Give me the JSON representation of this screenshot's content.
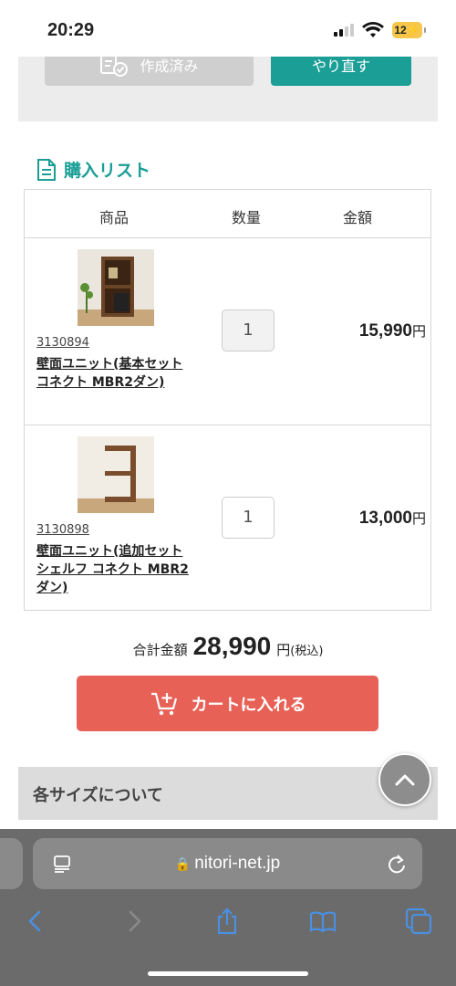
{
  "status": {
    "time": "20:29",
    "battery": "12"
  },
  "top_buttons": {
    "done_label": "作成済み",
    "redo_label": "やり直す"
  },
  "purchase_list": {
    "title": "購入リスト",
    "headers": [
      "商品",
      "数量",
      "金額"
    ],
    "items": [
      {
        "code": "3130894",
        "name": "壁面ユニット(基本セット コネクト MBR2ダン)",
        "qty": "1",
        "price": "15,990",
        "yen": "円"
      },
      {
        "code": "3130898",
        "name": "壁面ユニット(追加セット シェルフ コネクト MBR2ダン)",
        "qty": "1",
        "price": "13,000",
        "yen": "円"
      }
    ]
  },
  "total": {
    "label": "合計金額",
    "amount": "28,990",
    "suffix": "円",
    "tax": "(税込)"
  },
  "cart_button": "カートに入れる",
  "sizes_section": "各サイズについて",
  "browser": {
    "url": "nitori-net.jp"
  },
  "colors": {
    "accent": "#1a9e96",
    "cart": "#e86157"
  }
}
